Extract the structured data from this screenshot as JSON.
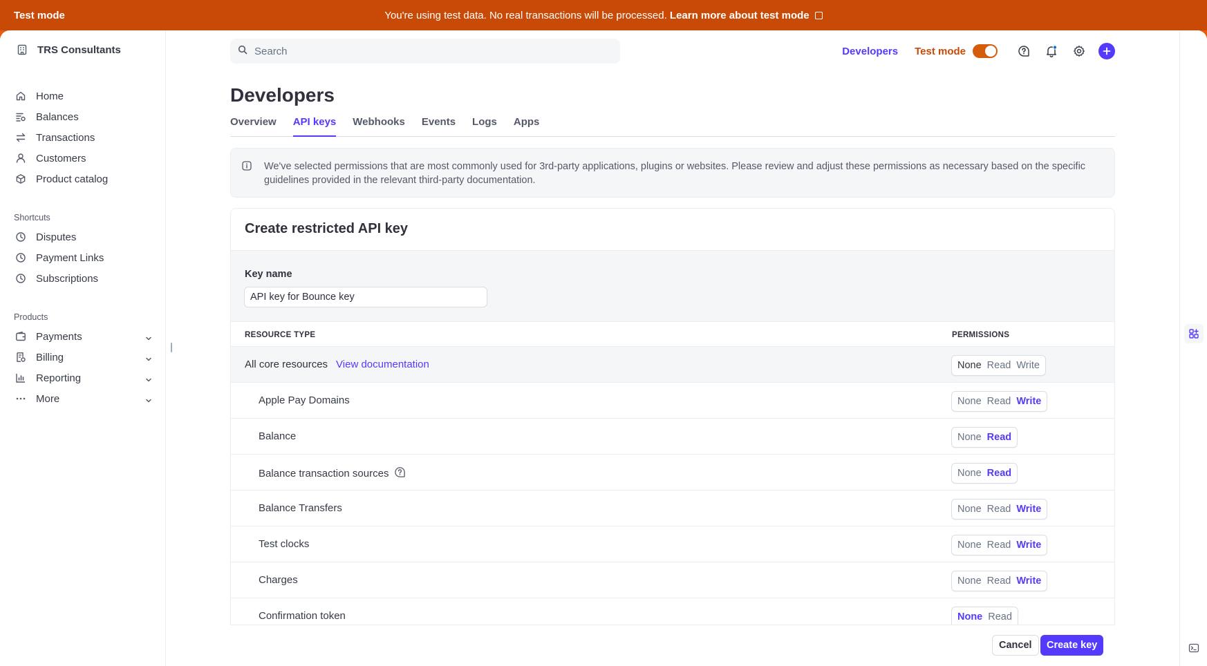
{
  "banner": {
    "label": "Test mode",
    "message": "You're using test data. No real transactions will be processed.",
    "link": "Learn more about test mode"
  },
  "sidebar": {
    "account": "TRS Consultants",
    "main": [
      {
        "label": "Home",
        "icon": "home-icon"
      },
      {
        "label": "Balances",
        "icon": "balances-icon"
      },
      {
        "label": "Transactions",
        "icon": "transactions-icon"
      },
      {
        "label": "Customers",
        "icon": "customers-icon"
      },
      {
        "label": "Product catalog",
        "icon": "product-icon"
      }
    ],
    "shortcuts_label": "Shortcuts",
    "shortcuts": [
      {
        "label": "Disputes",
        "icon": "clock-icon"
      },
      {
        "label": "Payment Links",
        "icon": "clock-icon"
      },
      {
        "label": "Subscriptions",
        "icon": "clock-icon"
      }
    ],
    "products_label": "Products",
    "products": [
      {
        "label": "Payments",
        "icon": "wallet-icon"
      },
      {
        "label": "Billing",
        "icon": "billing-icon"
      },
      {
        "label": "Reporting",
        "icon": "reporting-icon"
      },
      {
        "label": "More",
        "icon": "more-icon"
      }
    ]
  },
  "topbar": {
    "search_placeholder": "Search",
    "developers": "Developers",
    "test_mode": "Test mode"
  },
  "page": {
    "title": "Developers",
    "tabs": [
      "Overview",
      "API keys",
      "Webhooks",
      "Events",
      "Logs",
      "Apps"
    ],
    "active_tab": "API keys",
    "notice": "We've selected permissions that are most commonly used for 3rd-party applications, plugins or websites. Please review and adjust these permissions as necessary based on the specific guidelines provided in the relevant third-party documentation."
  },
  "card": {
    "title": "Create restricted API key",
    "key_name_label": "Key name",
    "key_name_value": "API key for Bounce key",
    "col_resource": "RESOURCE TYPE",
    "col_permissions": "PERMISSIONS",
    "core": {
      "label": "All core resources",
      "link": "View documentation"
    },
    "rows": [
      {
        "name": "Apple Pay Domains",
        "options": [
          "None",
          "Read",
          "Write"
        ],
        "selected": "Write"
      },
      {
        "name": "Balance",
        "options": [
          "None",
          "Read"
        ],
        "selected": "Read"
      },
      {
        "name": "Balance transaction sources",
        "options": [
          "None",
          "Read"
        ],
        "selected": "Read",
        "help": true
      },
      {
        "name": "Balance Transfers",
        "options": [
          "None",
          "Read",
          "Write"
        ],
        "selected": "Write"
      },
      {
        "name": "Test clocks",
        "options": [
          "None",
          "Read",
          "Write"
        ],
        "selected": "Write"
      },
      {
        "name": "Charges",
        "options": [
          "None",
          "Read",
          "Write"
        ],
        "selected": "Write"
      },
      {
        "name": "Confirmation token",
        "options": [
          "None",
          "Read"
        ],
        "selected": "None"
      }
    ],
    "core_options": [
      "None",
      "Read",
      "Write"
    ],
    "cancel": "Cancel",
    "create": "Create key"
  },
  "colors": {
    "accent": "#533afd",
    "banner": "#c94a06",
    "test_toggle": "#d45d0b"
  }
}
